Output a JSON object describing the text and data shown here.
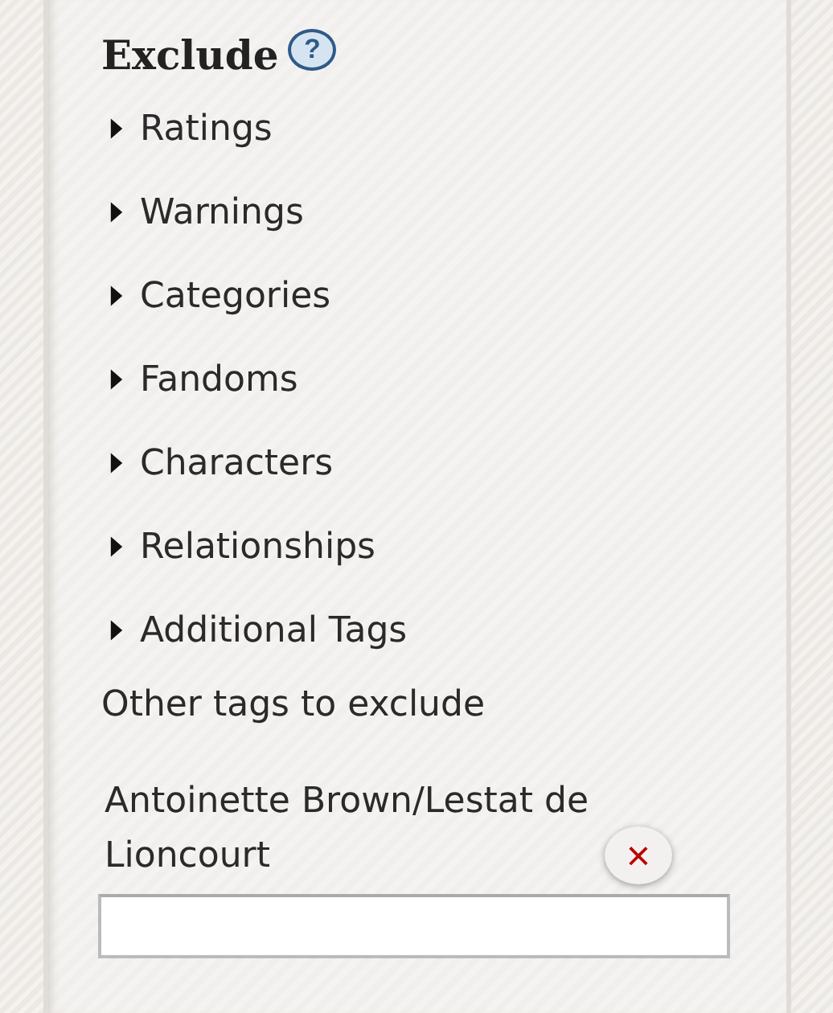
{
  "heading": "Exclude",
  "help": "?",
  "sections": [
    {
      "label": "Ratings",
      "expanded": false
    },
    {
      "label": "Warnings",
      "expanded": false
    },
    {
      "label": "Categories",
      "expanded": false
    },
    {
      "label": "Fandoms",
      "expanded": false
    },
    {
      "label": "Characters",
      "expanded": false
    },
    {
      "label": "Relationships",
      "expanded": false
    },
    {
      "label": "Additional Tags",
      "expanded": false
    }
  ],
  "other_tags": {
    "label": "Other tags to exclude",
    "tags": [
      {
        "text": "Antoinette Brown/Lestat de Lioncourt",
        "remove": "×"
      }
    ]
  }
}
